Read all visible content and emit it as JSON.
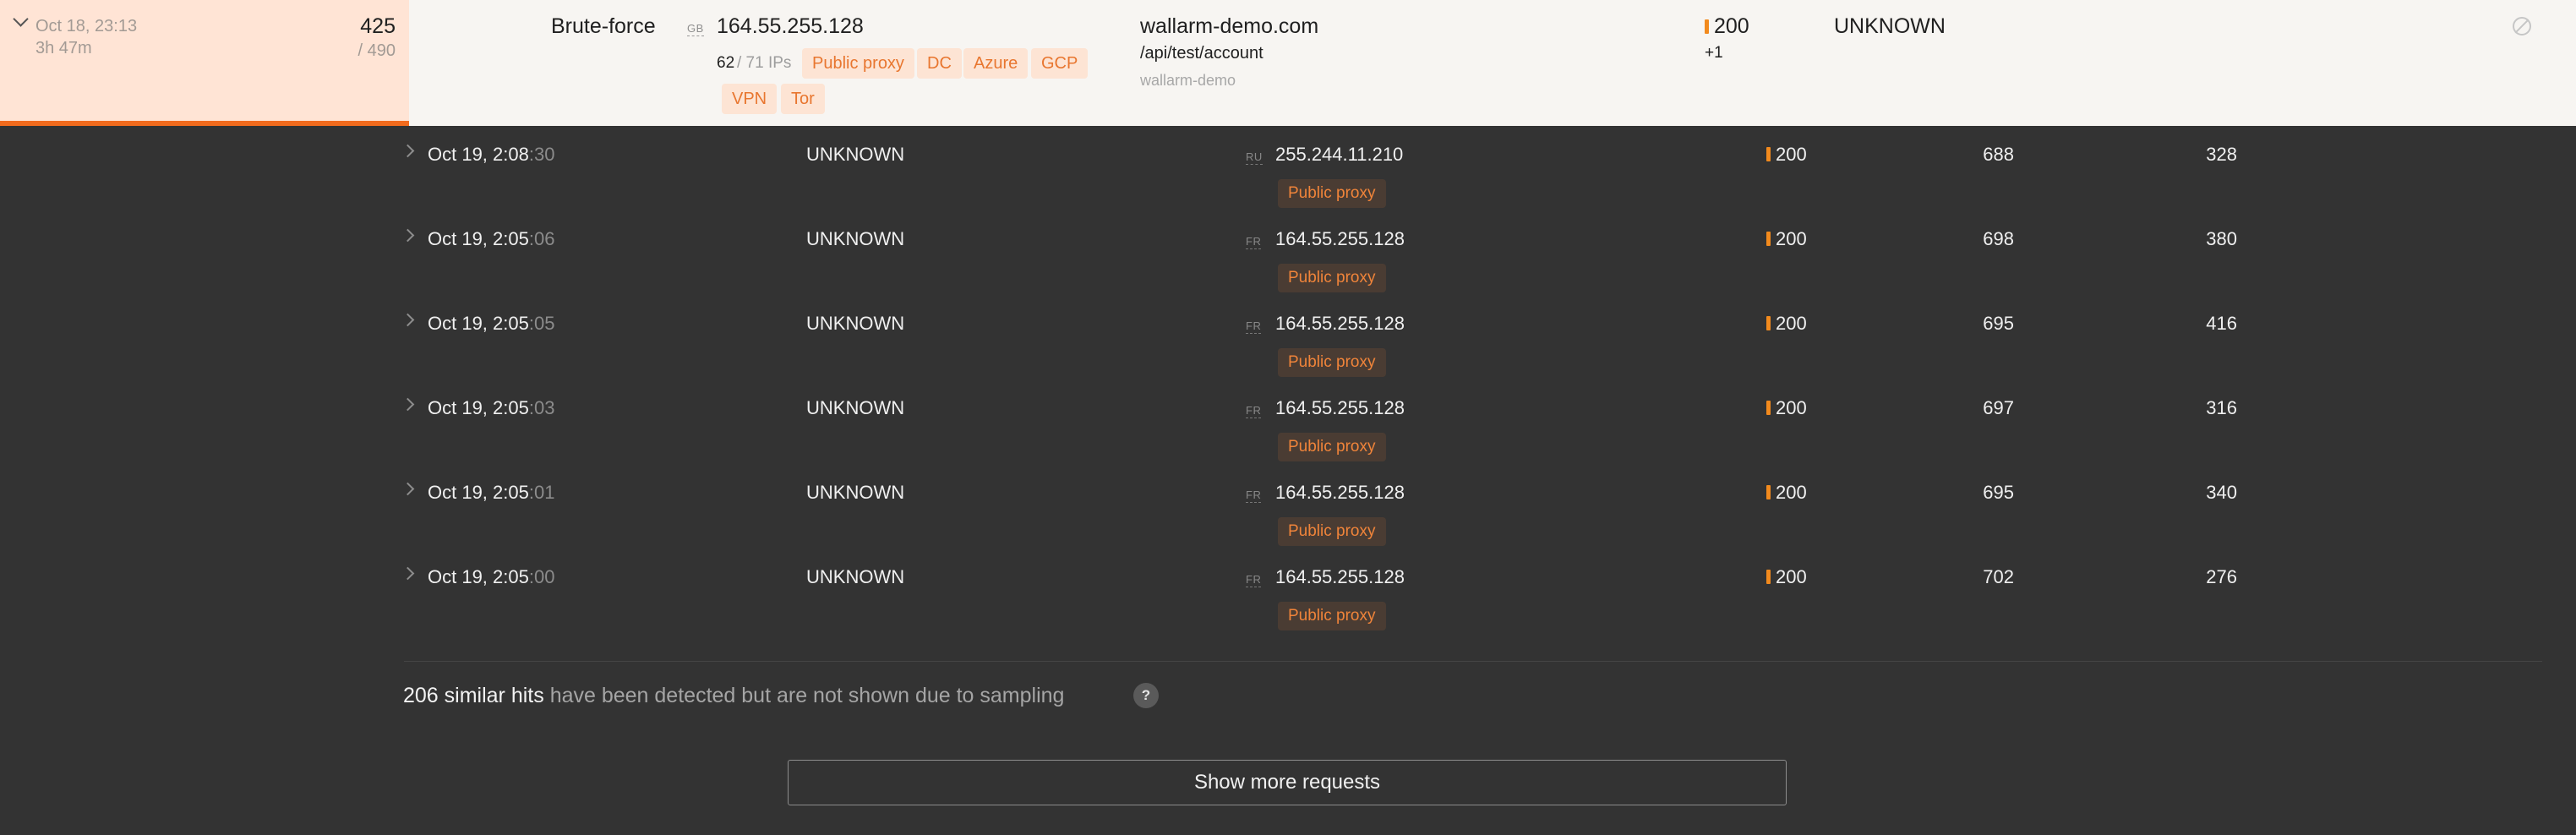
{
  "attack": {
    "date": "Oct 18, 23:13",
    "duration": "3h 47m",
    "hits": "425",
    "hits_total": "/ 490",
    "type": "Brute-force",
    "country": "GB",
    "ip": "164.55.255.128",
    "ip_count": "62",
    "ip_total": "/ 71 IPs",
    "sources": [
      "Public proxy",
      "DC",
      "Azure",
      "GCP",
      "VPN",
      "Tor"
    ],
    "domain": "wallarm-demo.com",
    "path": "/api/test/account",
    "application": "wallarm-demo",
    "status_code": "200",
    "status_extra": "+1",
    "parameter": "UNKNOWN",
    "icon": "cancel-icon"
  },
  "hits": [
    {
      "time_main": "Oct 19, 2:08",
      "time_sec": ":30",
      "param": "UNKNOWN",
      "country": "RU",
      "ip": "255.244.11.210",
      "source": "Public proxy",
      "code": "200",
      "size": "688",
      "duration": "328"
    },
    {
      "time_main": "Oct 19, 2:05",
      "time_sec": ":06",
      "param": "UNKNOWN",
      "country": "FR",
      "ip": "164.55.255.128",
      "source": "Public proxy",
      "code": "200",
      "size": "698",
      "duration": "380"
    },
    {
      "time_main": "Oct 19, 2:05",
      "time_sec": ":05",
      "param": "UNKNOWN",
      "country": "FR",
      "ip": "164.55.255.128",
      "source": "Public proxy",
      "code": "200",
      "size": "695",
      "duration": "416"
    },
    {
      "time_main": "Oct 19, 2:05",
      "time_sec": ":03",
      "param": "UNKNOWN",
      "country": "FR",
      "ip": "164.55.255.128",
      "source": "Public proxy",
      "code": "200",
      "size": "697",
      "duration": "316"
    },
    {
      "time_main": "Oct 19, 2:05",
      "time_sec": ":01",
      "param": "UNKNOWN",
      "country": "FR",
      "ip": "164.55.255.128",
      "source": "Public proxy",
      "code": "200",
      "size": "695",
      "duration": "340"
    },
    {
      "time_main": "Oct 19, 2:05",
      "time_sec": ":00",
      "param": "UNKNOWN",
      "country": "FR",
      "ip": "164.55.255.128",
      "source": "Public proxy",
      "code": "200",
      "size": "702",
      "duration": "276"
    }
  ],
  "sampling": {
    "count": "206 similar hits",
    "text": "have been detected but are not shown due to sampling",
    "help": "?"
  },
  "show_more_label": "Show more requests",
  "colors": {
    "accent": "#f26b1d",
    "status": "#f28a1d",
    "tag_text": "#e8762f"
  }
}
